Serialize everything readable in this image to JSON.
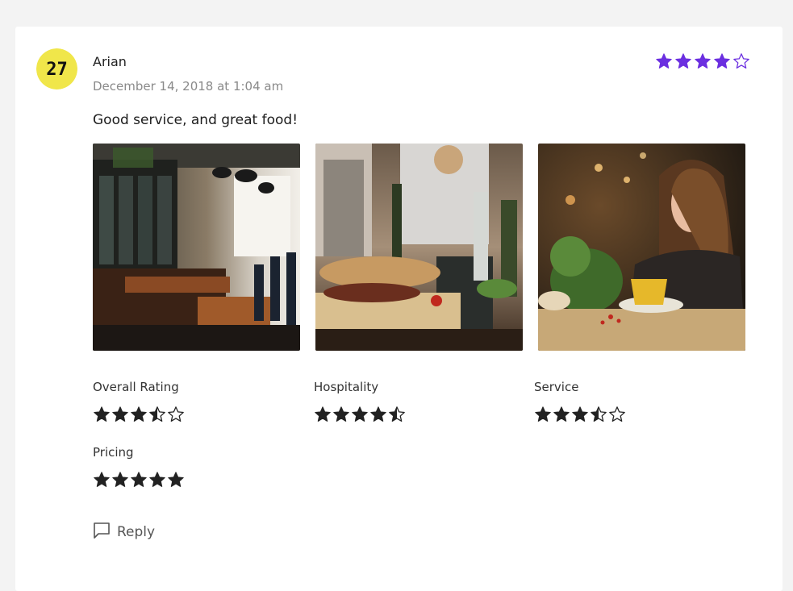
{
  "review": {
    "author": "Arian",
    "date": "December 14, 2018 at 1:04 am",
    "comment": "Good service, and great food!",
    "avatar_text": "27",
    "rating": 4,
    "accent_color": "#6b2fe0",
    "avatar_color": "#f0e64a"
  },
  "photos": [
    {
      "name": "restaurant-interior"
    },
    {
      "name": "table-food-spread"
    },
    {
      "name": "woman-eating"
    }
  ],
  "ratings": [
    {
      "label": "Overall Rating",
      "value": 3.5
    },
    {
      "label": "Hospitality",
      "value": 4.5
    },
    {
      "label": "Service",
      "value": 3.5
    },
    {
      "label": "Pricing",
      "value": 5
    }
  ],
  "actions": {
    "reply_label": "Reply"
  }
}
